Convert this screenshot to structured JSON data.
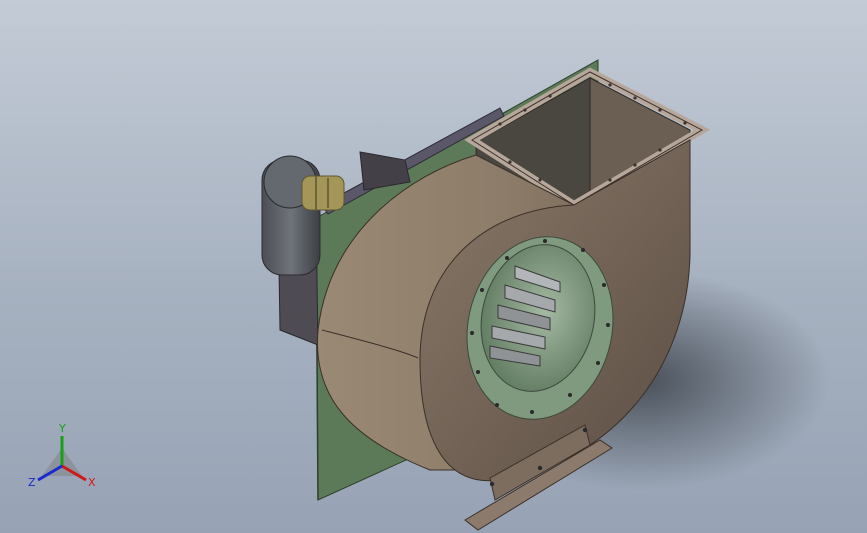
{
  "viewport": {
    "background_top": "#c3cbd6",
    "background_bottom": "#97a3b5"
  },
  "model": {
    "casing_color": "#9c8b78",
    "casing_shadow": "#6b5b4e",
    "backplate_color": "#5d7a58",
    "inlet_ring_color": "#7f9a7e",
    "motor_color": "#5a5e64",
    "coupling_color": "#a49658",
    "support_color": "#4e4b52"
  },
  "triad": {
    "x_label": "X",
    "y_label": "Y",
    "z_label": "Z",
    "x_color": "#d01818",
    "y_color": "#18a018",
    "z_color": "#1a2ad0"
  }
}
